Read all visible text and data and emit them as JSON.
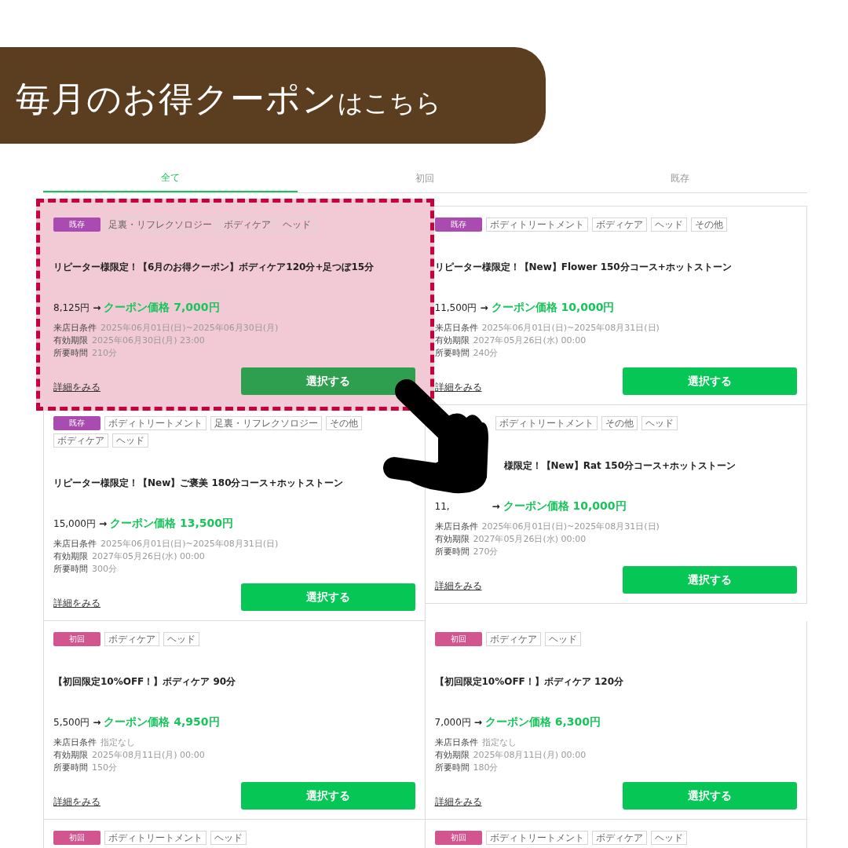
{
  "banner": {
    "title": "毎月のお得クーポン",
    "suffix": "はこちら"
  },
  "tabs": [
    {
      "label": "全て",
      "selected": true
    },
    {
      "label": "初回",
      "selected": false
    },
    {
      "label": "既存",
      "selected": false
    }
  ],
  "cards": [
    {
      "highlighted": true,
      "obscured": false,
      "badge": {
        "label": "既存",
        "color": "#a94bb0"
      },
      "tags": [
        "足裏・リフレクソロジー",
        "ボディケア",
        "ヘッド"
      ],
      "title": "リピーター様限定！【6月のお得クーポン】ボディケア120分+足つぼ15分",
      "original_price": "8,125円",
      "arrow": "→",
      "coupon_price": "クーポン価格 7,000円",
      "info": [
        {
          "label": "来店日条件",
          "value": "2025年06月01日(日)~2025年06月30日(月)"
        },
        {
          "label": "有効期限",
          "value": "2025年06月30日(月) 23:00"
        },
        {
          "label": "所要時間",
          "value": "210分"
        }
      ],
      "link": "詳細をみる",
      "button": "選択する"
    },
    {
      "highlighted": false,
      "obscured": false,
      "badge": {
        "label": "既存",
        "color": "#a94bb0"
      },
      "tags": [
        "ボディトリートメント",
        "ボディケア",
        "ヘッド",
        "その他"
      ],
      "title": "リピーター様限定！【New】Flower 150分コース+ホットストーン",
      "original_price": "11,500円",
      "arrow": "→",
      "coupon_price": "クーポン価格 10,000円",
      "info": [
        {
          "label": "来店日条件",
          "value": "2025年06月01日(日)~2025年08月31日(日)"
        },
        {
          "label": "有効期限",
          "value": "2027年05月26日(水) 00:00"
        },
        {
          "label": "所要時間",
          "value": "240分"
        }
      ],
      "link": "詳細をみる",
      "button": "選択する"
    },
    {
      "highlighted": false,
      "obscured": false,
      "badge": {
        "label": "既存",
        "color": "#a94bb0"
      },
      "tags": [
        "ボディトリートメント",
        "足裏・リフレクソロジー",
        "その他",
        "ボディケア",
        "ヘッド"
      ],
      "title": "リピーター様限定！【New】ご褒美 180分コース+ホットストーン",
      "original_price": "15,000円",
      "arrow": "→",
      "coupon_price": "クーポン価格 13,500円",
      "info": [
        {
          "label": "来店日条件",
          "value": "2025年06月01日(日)~2025年08月31日(日)"
        },
        {
          "label": "有効期限",
          "value": "2027年05月26日(水) 00:00"
        },
        {
          "label": "所要時間",
          "value": "300分"
        }
      ],
      "link": "詳細をみる",
      "button": "選択する"
    },
    {
      "highlighted": false,
      "obscured": true,
      "tags": [
        "ボディトリートメント",
        "その他",
        "ヘッド"
      ],
      "title": "様限定！【New】Rat 150分コース+ホットストーン",
      "original_price": "11,",
      "arrow": "→",
      "coupon_price": "クーポン価格 10,000円",
      "info": [
        {
          "label": "来店日条件",
          "value": "2025年06月01日(日)~2025年08月31日(日)"
        },
        {
          "label": "有効期限",
          "value": "2027年05月26日(水) 00:00"
        },
        {
          "label": "所要時間",
          "value": "270分"
        }
      ],
      "link": "詳細をみる",
      "button": "選択する"
    },
    {
      "highlighted": false,
      "obscured": false,
      "badge": {
        "label": "初回",
        "color": "#d2558f"
      },
      "tags": [
        "ボディケア",
        "ヘッド"
      ],
      "title": "【初回限定10%OFF！】ボディケア 90分",
      "original_price": "5,500円",
      "arrow": "→",
      "coupon_price": "クーポン価格 4,950円",
      "info": [
        {
          "label": "来店日条件",
          "value": "指定なし"
        },
        {
          "label": "有効期限",
          "value": "2025年08月11日(月) 00:00"
        },
        {
          "label": "所要時間",
          "value": "150分"
        }
      ],
      "link": "詳細をみる",
      "button": "選択する"
    },
    {
      "highlighted": false,
      "obscured": false,
      "badge": {
        "label": "初回",
        "color": "#d2558f"
      },
      "tags": [
        "ボディケア",
        "ヘッド"
      ],
      "title": "【初回限定10%OFF！】ボディケア 120分",
      "original_price": "7,000円",
      "arrow": "→",
      "coupon_price": "クーポン価格 6,300円",
      "info": [
        {
          "label": "来店日条件",
          "value": "指定なし"
        },
        {
          "label": "有効期限",
          "value": "2025年08月11日(月) 00:00"
        },
        {
          "label": "所要時間",
          "value": "180分"
        }
      ],
      "link": "詳細をみる",
      "button": "選択する"
    },
    {
      "highlighted": false,
      "badge": {
        "label": "初回",
        "color": "#d2558f"
      },
      "tags": [
        "ボディトリートメント",
        "ヘッド"
      ]
    },
    {
      "highlighted": false,
      "badge": {
        "label": "初回",
        "color": "#d2558f"
      },
      "tags": [
        "ボディトリートメント",
        "ボディケア",
        "ヘッド"
      ]
    }
  ]
}
